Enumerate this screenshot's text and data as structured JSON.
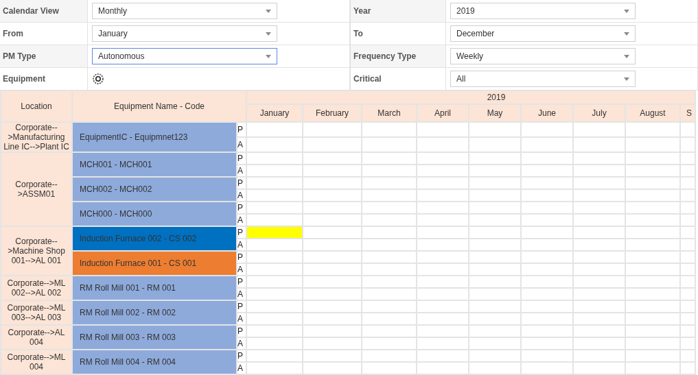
{
  "filters": [
    {
      "label": "Calendar View",
      "kind": "select",
      "value": "Monthly",
      "focused": false
    },
    {
      "label": "Year",
      "kind": "select",
      "value": "2019",
      "focused": false
    },
    {
      "label": "From",
      "kind": "select",
      "value": "January",
      "focused": false
    },
    {
      "label": "To",
      "kind": "select",
      "value": "December",
      "focused": false
    },
    {
      "label": "PM Type",
      "kind": "select",
      "value": "Autonomous",
      "focused": true
    },
    {
      "label": "Frequency Type",
      "kind": "select",
      "value": "Weekly",
      "focused": false
    },
    {
      "label": "Equipment",
      "kind": "picker"
    },
    {
      "label": "Critical",
      "kind": "select",
      "value": "All",
      "focused": false
    }
  ],
  "table": {
    "columns": [
      "Location",
      "Equipment Name - Code"
    ],
    "year": "2019",
    "months": [
      "January",
      "February",
      "March",
      "April",
      "May",
      "June",
      "July",
      "August",
      "S"
    ],
    "groups": [
      {
        "location": "Corporate-->Manufacturing Line IC-->Plant IC",
        "equipment": [
          {
            "name": "EquipmentIC - Equipmnet123",
            "color": "#8eaadb",
            "rows": [
              {
                "label": "P",
                "marks": [
                  false,
                  false,
                  false,
                  false,
                  false,
                  false,
                  false,
                  false,
                  false
                ]
              },
              {
                "label": "A",
                "marks": [
                  false,
                  false,
                  false,
                  false,
                  false,
                  false,
                  false,
                  false,
                  false
                ]
              }
            ]
          }
        ]
      },
      {
        "location": "Corporate-->ASSM01",
        "equipment": [
          {
            "name": "MCH001 - MCH001",
            "color": "#8eaadb",
            "rows": [
              {
                "label": "P",
                "marks": [
                  false,
                  false,
                  false,
                  false,
                  false,
                  false,
                  false,
                  false,
                  false
                ]
              },
              {
                "label": "A",
                "marks": [
                  false,
                  false,
                  false,
                  false,
                  false,
                  false,
                  false,
                  false,
                  false
                ]
              }
            ]
          },
          {
            "name": "MCH002 - MCH002",
            "color": "#8eaadb",
            "rows": [
              {
                "label": "P",
                "marks": [
                  false,
                  false,
                  false,
                  false,
                  false,
                  false,
                  false,
                  false,
                  false
                ]
              },
              {
                "label": "A",
                "marks": [
                  false,
                  false,
                  false,
                  false,
                  false,
                  false,
                  false,
                  false,
                  false
                ]
              }
            ]
          },
          {
            "name": "MCH000 - MCH000",
            "color": "#8eaadb",
            "rows": [
              {
                "label": "P",
                "marks": [
                  false,
                  false,
                  false,
                  false,
                  false,
                  false,
                  false,
                  false,
                  false
                ]
              },
              {
                "label": "A",
                "marks": [
                  false,
                  false,
                  false,
                  false,
                  false,
                  false,
                  false,
                  false,
                  false
                ]
              }
            ]
          }
        ]
      },
      {
        "location": "Corporate-->Machine Shop 001-->AL 001",
        "equipment": [
          {
            "name": "Induction Furnace 002 - CS 002",
            "color": "#0070c0",
            "rows": [
              {
                "label": "P",
                "marks": [
                  true,
                  false,
                  false,
                  false,
                  false,
                  false,
                  false,
                  false,
                  false
                ]
              },
              {
                "label": "A",
                "marks": [
                  false,
                  false,
                  false,
                  false,
                  false,
                  false,
                  false,
                  false,
                  false
                ]
              }
            ]
          },
          {
            "name": "Induction Furnace 001 - CS 001",
            "color": "#ed7d31",
            "rows": [
              {
                "label": "P",
                "marks": [
                  false,
                  false,
                  false,
                  false,
                  false,
                  false,
                  false,
                  false,
                  false
                ]
              },
              {
                "label": "A",
                "marks": [
                  false,
                  false,
                  false,
                  false,
                  false,
                  false,
                  false,
                  false,
                  false
                ]
              }
            ]
          }
        ]
      },
      {
        "location": "Corporate-->ML 002-->AL 002",
        "equipment": [
          {
            "name": "RM Roll Mill 001 - RM 001",
            "color": "#8eaadb",
            "rows": [
              {
                "label": "P",
                "marks": [
                  false,
                  false,
                  false,
                  false,
                  false,
                  false,
                  false,
                  false,
                  false
                ]
              },
              {
                "label": "A",
                "marks": [
                  false,
                  false,
                  false,
                  false,
                  false,
                  false,
                  false,
                  false,
                  false
                ]
              }
            ]
          }
        ]
      },
      {
        "location": "Corporate-->ML 003-->AL 003",
        "equipment": [
          {
            "name": "RM Roll Mill 002 - RM 002",
            "color": "#8eaadb",
            "rows": [
              {
                "label": "P",
                "marks": [
                  false,
                  false,
                  false,
                  false,
                  false,
                  false,
                  false,
                  false,
                  false
                ]
              },
              {
                "label": "A",
                "marks": [
                  false,
                  false,
                  false,
                  false,
                  false,
                  false,
                  false,
                  false,
                  false
                ]
              }
            ]
          }
        ]
      },
      {
        "location": "Corporate-->AL 004",
        "equipment": [
          {
            "name": "RM Roll Mill 003 - RM 003",
            "color": "#8eaadb",
            "rows": [
              {
                "label": "P",
                "marks": [
                  false,
                  false,
                  false,
                  false,
                  false,
                  false,
                  false,
                  false,
                  false
                ]
              },
              {
                "label": "A",
                "marks": [
                  false,
                  false,
                  false,
                  false,
                  false,
                  false,
                  false,
                  false,
                  false
                ]
              }
            ]
          }
        ]
      },
      {
        "location": "Corporate-->ML 004",
        "equipment": [
          {
            "name": "RM Roll Mill 004 - RM 004",
            "color": "#8eaadb",
            "rows": [
              {
                "label": "P",
                "marks": [
                  false,
                  false,
                  false,
                  false,
                  false,
                  false,
                  false,
                  false,
                  false
                ]
              },
              {
                "label": "A",
                "marks": [
                  false,
                  false,
                  false,
                  false,
                  false,
                  false,
                  false,
                  false,
                  false
                ]
              }
            ]
          }
        ]
      }
    ]
  }
}
